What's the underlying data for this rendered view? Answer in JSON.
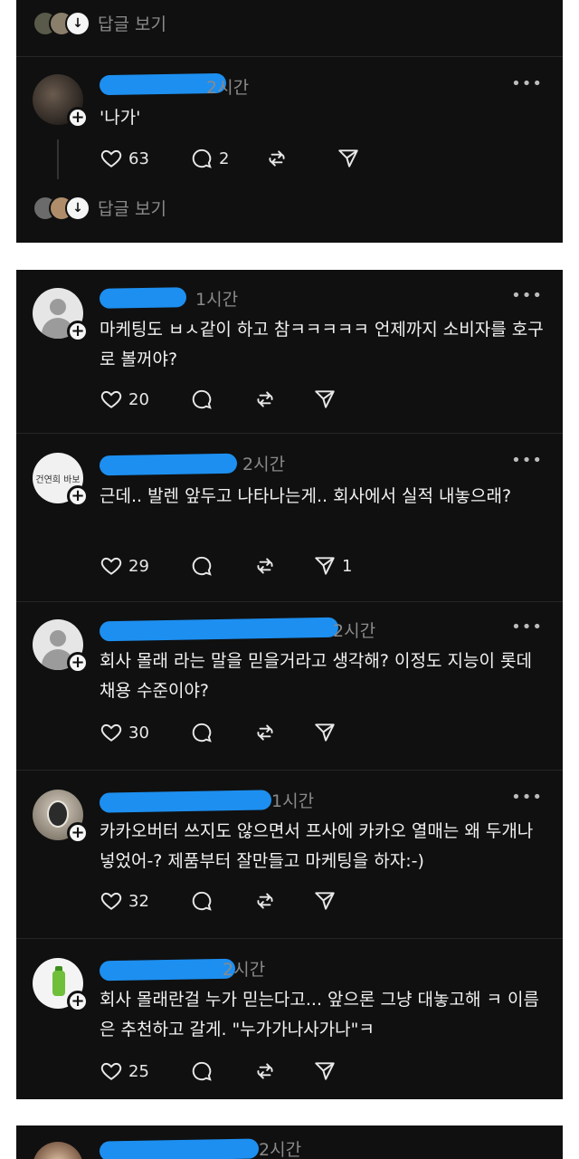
{
  "thread": {
    "top_replies_label": "답글 보기",
    "main_post": {
      "time": "2시간",
      "text": "'나가'",
      "likes": "63",
      "comments": "2",
      "reposts": "",
      "shares": ""
    },
    "bottom_replies_label": "답글 보기"
  },
  "replies": [
    {
      "time": "1시간",
      "text": "마케팅도 ㅂㅅ같이 하고 참ㅋㅋㅋㅋㅋ 언제까지 소비자를 호구로 볼꺼야?",
      "likes": "20",
      "shares": ""
    },
    {
      "time": "2시간",
      "avatar_text": "건연희 바보",
      "text": "근데.. 발렌 앞두고 나타나는게.. 회사에서 실적 내놓으래?",
      "likes": "29",
      "shares": "1"
    },
    {
      "time": "2시간",
      "text": "회사 몰래 라는 말을 믿을거라고 생각해? 이정도 지능이 롯데 채용 수준이야?",
      "likes": "30",
      "shares": ""
    },
    {
      "time": "1시간",
      "text": "카카오버터 쓰지도 않으면서 프사에 카카오 열매는 왜 두개나 넣었어-? 제품부터 잘만들고 마케팅을 하자:-)",
      "likes": "32",
      "shares": ""
    },
    {
      "time": "2시간",
      "text": "회사 몰래란걸 누가 믿는다고... 앞으론 그냥 대놓고해 ㅋ 이름은 추천하고 갈게. \"누가가나사가나\"ㅋ",
      "likes": "25",
      "shares": ""
    }
  ],
  "next_post": {
    "time": "2시간"
  },
  "more_label": "•••",
  "colors": {
    "background": "#101010",
    "redaction": "#1d8ff0",
    "muted": "#8a8a8a",
    "text": "#f2f2f2"
  },
  "icons": [
    "heart-icon",
    "comment-icon",
    "repost-icon",
    "share-icon",
    "plus-icon",
    "more-icon",
    "chevron-down-icon"
  ]
}
